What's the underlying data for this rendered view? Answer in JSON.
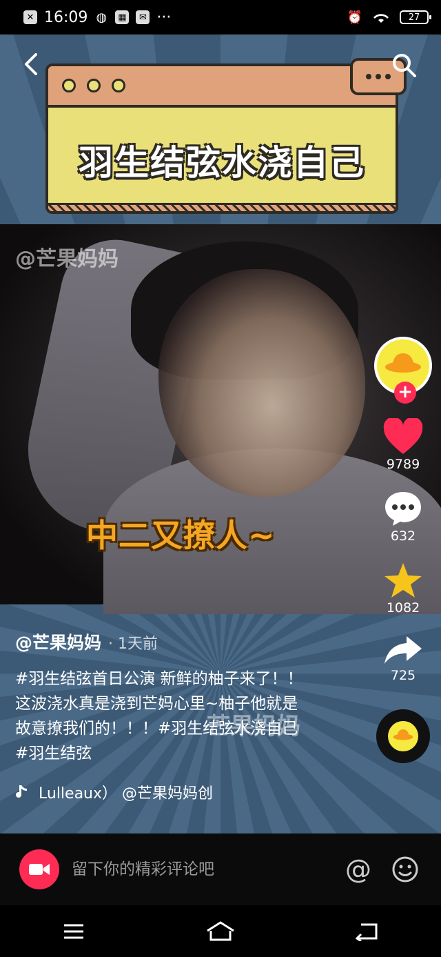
{
  "status_bar": {
    "time": "16:09",
    "icons_left": [
      "sim-icon",
      "wechat-icon",
      "app-icon",
      "mail-icon",
      "more-icon"
    ],
    "more": "···",
    "battery": "27"
  },
  "video": {
    "title_card": "羽生结弦水浇自己",
    "watermark": "@芒果妈妈",
    "watermark_center": "芒果妈妈",
    "caption": "中二又撩人~"
  },
  "actions": {
    "likes": "9789",
    "comments": "632",
    "favorites": "1082",
    "shares": "725"
  },
  "post": {
    "author": "@芒果妈妈",
    "time": "· 1天前",
    "description": "#羽生结弦首日公演 新鲜的柚子来了！！ 这波浇水真是浇到芒妈心里~柚子他就是故意撩我们的！！！#羽生结弦水浇自己 #羽生结弦",
    "music": "Lulleaux）    @芒果妈妈创"
  },
  "comment_bar": {
    "placeholder": "留下你的精彩评论吧"
  },
  "colors": {
    "accent": "#fe2c55",
    "card_yellow": "#e9e07a",
    "card_orange": "#e0a27a",
    "caption": "#f5a623"
  }
}
